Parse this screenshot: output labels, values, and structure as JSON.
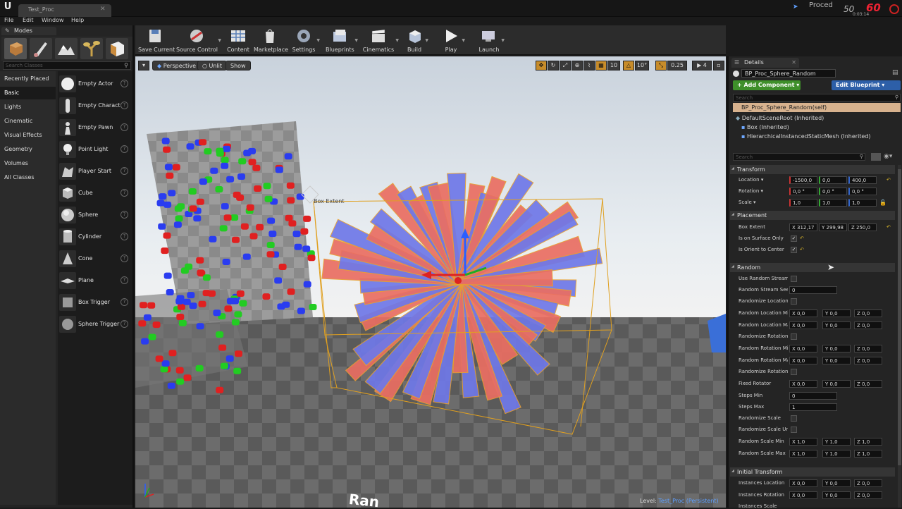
{
  "window": {
    "tab_title": "Test_Proc",
    "project_name": "Proced",
    "fps_value": "60",
    "frame_ms": "50",
    "stat_text": "0:03:14"
  },
  "menu": [
    "File",
    "Edit",
    "Window",
    "Help"
  ],
  "modes": {
    "tab_label": "Modes",
    "search_placeholder": "Search Classes",
    "categories": [
      "Recently Placed",
      "Basic",
      "Lights",
      "Cinematic",
      "Visual Effects",
      "Geometry",
      "Volumes",
      "All Classes"
    ],
    "selected_category": "Basic",
    "actors": [
      "Empty Actor",
      "Empty Charact",
      "Empty Pawn",
      "Point Light",
      "Player Start",
      "Cube",
      "Sphere",
      "Cylinder",
      "Cone",
      "Plane",
      "Box Trigger",
      "Sphere Trigger"
    ]
  },
  "toolbar": {
    "save": "Save Current",
    "source": "Source Control",
    "content": "Content",
    "marketplace": "Marketplace",
    "settings": "Settings",
    "blueprints": "Blueprints",
    "cinematics": "Cinematics",
    "build": "Build",
    "play": "Play",
    "launch": "Launch"
  },
  "viewport": {
    "perspective": "Perspective",
    "lit": "Unlit",
    "show": "Show",
    "grid_snap": "10",
    "rot_snap": "10°",
    "scale_snap": "0.25",
    "cam_speed": "4",
    "box_extent_label": "Box Extent",
    "level_prefix": "Level:",
    "level_name": "Test_Proc (Persistent)",
    "overlay_text": "Ran"
  },
  "details": {
    "tab_label": "Details",
    "actor_name": "BP_Proc_Sphere_Random",
    "add_component": "+ Add Component ▾",
    "edit_blueprint": "Edit Blueprint ▾",
    "search_placeholder": "Search",
    "components": {
      "self": "BP_Proc_Sphere_Random(self)",
      "root": "DefaultSceneRoot (Inherited)",
      "box": "Box (Inherited)",
      "hism": "HierarchicalInstancedStaticMesh (Inherited)"
    },
    "sections": {
      "transform": "Transform",
      "placement": "Placement",
      "random": "Random",
      "initial": "Initial Transform"
    },
    "transform": {
      "location_label": "Location ▾",
      "location": [
        "-1500,0",
        "0,0",
        "400,0"
      ],
      "rotation_label": "Rotation ▾",
      "rotation": [
        "0,0 °",
        "0,0 °",
        "0,0 °"
      ],
      "scale_label": "Scale ▾",
      "scale": [
        "1,0",
        "1,0",
        "1,0"
      ]
    },
    "placement": {
      "box_extent_label": "Box Extent",
      "box_extent": [
        "X 312,17",
        "Y 299,98",
        "Z 250,0"
      ],
      "surface_only_label": "Is on Surface Only",
      "orient_label": "Is Orient to Center"
    },
    "random": {
      "use_stream": "Use Random Stream",
      "stream_seed": "Random Stream Seed",
      "stream_seed_value": "0",
      "randomize_location": "Randomize Location",
      "loc_min": "Random Location Min",
      "loc_max": "Random Location Max",
      "randomize_rotation": "Randomize Rotation",
      "rot_min": "Random Rotation Min",
      "rot_max": "Random Rotation Max",
      "randomize_rotation2": "Randomize Rotation",
      "fixed_rotator": "Fixed Rotator",
      "steps_min": "Steps Min",
      "steps_min_value": "0",
      "steps_max": "Steps Max",
      "steps_max_value": "1",
      "randomize_scale": "Randomize Scale",
      "randomize_scale_uniform": "Randomize Scale Uniform",
      "scale_min": "Random Scale Min",
      "scale_max": "Random Scale Max",
      "zero_vec": [
        "X 0,0",
        "Y 0,0",
        "Z 0,0"
      ],
      "one_vec": [
        "X 1,0",
        "Y 1,0",
        "Z 1,0"
      ]
    },
    "initial": {
      "inst_location": "Instances Location",
      "inst_rotation": "Instances Rotation",
      "inst_scale": "Instances Scale",
      "zero_vec": [
        "X 0,0",
        "Y 0,0",
        "Z 0,0"
      ]
    }
  }
}
